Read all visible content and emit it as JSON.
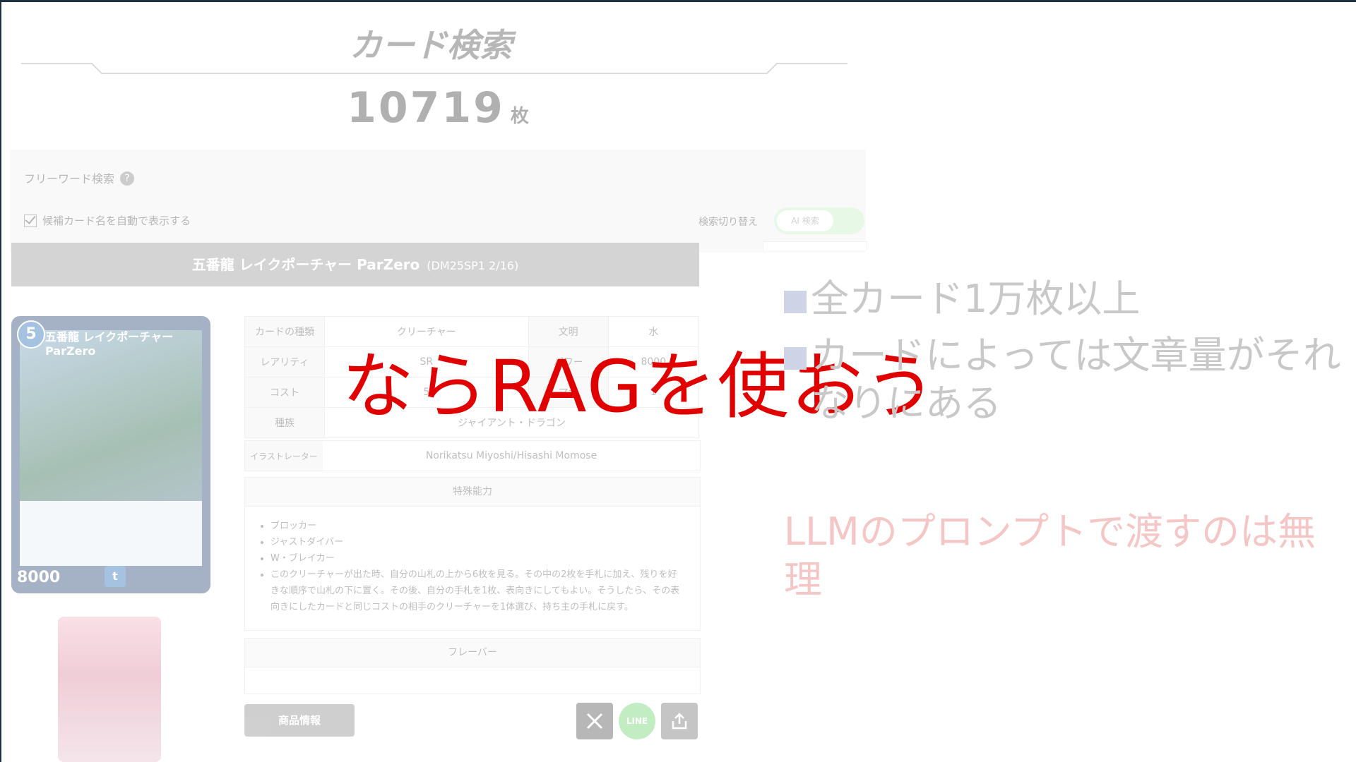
{
  "page": {
    "title": "カード検索",
    "count_number": "10719",
    "count_unit": "枚"
  },
  "search": {
    "label": "フリーワード検索",
    "help_glyph": "?",
    "autocomplete_label": "候補カード名を自動で表示する",
    "switch_label": "検索切り替え",
    "toggle_label": "AI 検索"
  },
  "card": {
    "name": "五番龍 レイクポーチャー ParZero",
    "code": "(DM25SP1 2/16)",
    "image": {
      "cost": "5",
      "name": "五番龍 レイクポーチャー ParZero",
      "power": "8000"
    },
    "table": [
      {
        "h1": "カードの種類",
        "v1": "クリーチャー",
        "h2": "文明",
        "v2": "水"
      },
      {
        "h1": "レアリティ",
        "v1": "SR",
        "h2": "パワー",
        "v2": "8000"
      },
      {
        "h1": "コスト",
        "v1": "5",
        "h2": "マナ",
        "v2": "1"
      }
    ],
    "race_label": "種族",
    "race": "ジャイアント・ドラゴン",
    "illustrator_label": "イラストレーター",
    "illustrator": "Norikatsu Miyoshi/Hisashi Momose",
    "ability_head": "特殊能力",
    "abilities": [
      "ブロッカー",
      "ジャストダイバー",
      "W・ブレイカー",
      "このクリーチャーが出た時、自分の山札の上から6枚を見る。その中の2枚を手札に加え、残りを好きな順序で山札の下に置く。その後、自分の手札を1枚、表向きにしてもよい。そうしたら、その表向きにしたカードと同じコストの相手のクリーチャーを1体選び、持ち主の手札に戻す。"
    ],
    "flavor_head": "フレーバー"
  },
  "buttons": {
    "product_info": "商品情報",
    "share_x": "X",
    "share_line": "LINE"
  },
  "slide": {
    "headline": "ならRAGを使おう",
    "bullets": [
      "全カード1万枚以上",
      "カードによっては文章量がそれなりにある"
    ],
    "note": "LLMのプロンプトで渡すのは無理"
  },
  "colors": {
    "headline": "#e00000",
    "note": "#f5c6c6",
    "bullet": "#c8c8c8"
  }
}
